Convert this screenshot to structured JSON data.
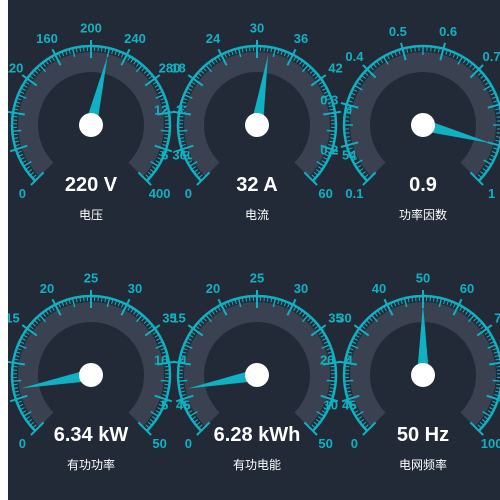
{
  "theme": {
    "background": "#222a38",
    "accent": "#0fb1c2",
    "track": "#3a4150",
    "text": "#ffffff"
  },
  "gauges": [
    {
      "name": "电压",
      "value": 220,
      "display": "220 V",
      "unit": "V",
      "min": 0,
      "max": 400,
      "major_labels": [
        "0",
        "40",
        "80",
        "120",
        "160",
        "200",
        "240",
        "280",
        "320",
        "360",
        "400"
      ]
    },
    {
      "name": "电流",
      "value": 32,
      "display": "32 A",
      "unit": "A",
      "min": 0,
      "max": 60,
      "major_labels": [
        "0",
        "6",
        "12",
        "18",
        "24",
        "30",
        "36",
        "42",
        "48",
        "54",
        "60"
      ]
    },
    {
      "name": "功率因数",
      "value": 0.9,
      "display": "0.9",
      "unit": "",
      "min": 0.1,
      "max": 1,
      "major_labels": [
        "0.1",
        "0.2",
        "0.3",
        "0.4",
        "0.5",
        "0.6",
        "0.7",
        "0.8",
        "0.9",
        "1"
      ]
    },
    {
      "name": "有功功率",
      "value": 6.34,
      "display": "6.34 kW",
      "unit": "kW",
      "min": 0,
      "max": 50,
      "major_labels": [
        "0",
        "5",
        "10",
        "15",
        "20",
        "25",
        "30",
        "35",
        "40",
        "45",
        "50"
      ]
    },
    {
      "name": "有功电能",
      "value": 6.28,
      "display": "6.28 kWh",
      "unit": "kWh",
      "min": 0,
      "max": 50,
      "major_labels": [
        "0",
        "5",
        "10",
        "15",
        "20",
        "25",
        "30",
        "35",
        "40",
        "45",
        "50"
      ]
    },
    {
      "name": "电网频率",
      "value": 50,
      "display": "50 Hz",
      "unit": "Hz",
      "min": 0,
      "max": 100,
      "major_labels": [
        "0",
        "10",
        "20",
        "30",
        "40",
        "50",
        "60",
        "70",
        "80",
        "90",
        "100"
      ]
    }
  ]
}
